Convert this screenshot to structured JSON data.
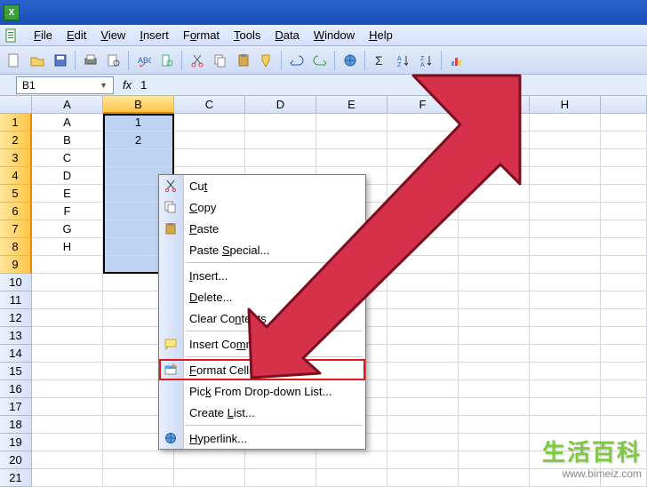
{
  "menubar": {
    "items": [
      {
        "pre": "",
        "ul": "F",
        "post": "ile"
      },
      {
        "pre": "",
        "ul": "E",
        "post": "dit"
      },
      {
        "pre": "",
        "ul": "V",
        "post": "iew"
      },
      {
        "pre": "",
        "ul": "I",
        "post": "nsert"
      },
      {
        "pre": "F",
        "ul": "o",
        "post": "rmat"
      },
      {
        "pre": "",
        "ul": "T",
        "post": "ools"
      },
      {
        "pre": "",
        "ul": "D",
        "post": "ata"
      },
      {
        "pre": "",
        "ul": "W",
        "post": "indow"
      },
      {
        "pre": "",
        "ul": "H",
        "post": "elp"
      }
    ]
  },
  "namebox": {
    "value": "B1"
  },
  "formula": {
    "fx": "fx",
    "value": "1"
  },
  "columns": [
    "A",
    "B",
    "C",
    "D",
    "E",
    "F",
    "G",
    "H"
  ],
  "active_column_index": 1,
  "rows": [
    {
      "n": "1",
      "a": "A",
      "b": "1",
      "active": true
    },
    {
      "n": "2",
      "a": "B",
      "b": "2",
      "active": true
    },
    {
      "n": "3",
      "a": "C",
      "b": "",
      "active": true
    },
    {
      "n": "4",
      "a": "D",
      "b": "",
      "active": true
    },
    {
      "n": "5",
      "a": "E",
      "b": "",
      "active": true
    },
    {
      "n": "6",
      "a": "F",
      "b": "",
      "active": true
    },
    {
      "n": "7",
      "a": "G",
      "b": "",
      "active": true
    },
    {
      "n": "8",
      "a": "H",
      "b": "",
      "active": true
    },
    {
      "n": "9",
      "a": "",
      "b": "",
      "active": true
    },
    {
      "n": "10",
      "a": "",
      "b": "",
      "active": false
    },
    {
      "n": "11",
      "a": "",
      "b": "",
      "active": false
    },
    {
      "n": "12",
      "a": "",
      "b": "",
      "active": false
    },
    {
      "n": "13",
      "a": "",
      "b": "",
      "active": false
    },
    {
      "n": "14",
      "a": "",
      "b": "",
      "active": false
    },
    {
      "n": "15",
      "a": "",
      "b": "",
      "active": false
    },
    {
      "n": "16",
      "a": "",
      "b": "",
      "active": false
    },
    {
      "n": "17",
      "a": "",
      "b": "",
      "active": false
    },
    {
      "n": "18",
      "a": "",
      "b": "",
      "active": false
    },
    {
      "n": "19",
      "a": "",
      "b": "",
      "active": false
    },
    {
      "n": "20",
      "a": "",
      "b": "",
      "active": false
    },
    {
      "n": "21",
      "a": "",
      "b": "",
      "active": false
    }
  ],
  "context_menu": {
    "items": [
      {
        "icon": "cut",
        "pre": "Cu",
        "ul": "t",
        "post": ""
      },
      {
        "icon": "copy",
        "pre": "",
        "ul": "C",
        "post": "opy"
      },
      {
        "icon": "paste",
        "pre": "",
        "ul": "P",
        "post": "aste"
      },
      {
        "icon": "",
        "pre": "Paste ",
        "ul": "S",
        "post": "pecial..."
      },
      {
        "sep": true
      },
      {
        "icon": "",
        "pre": "",
        "ul": "I",
        "post": "nsert..."
      },
      {
        "icon": "",
        "pre": "",
        "ul": "D",
        "post": "elete..."
      },
      {
        "icon": "",
        "pre": "Clear Co",
        "ul": "n",
        "post": "tents"
      },
      {
        "sep": true
      },
      {
        "icon": "comment",
        "pre": "Insert Co",
        "ul": "m",
        "post": "ment"
      },
      {
        "sep": true
      },
      {
        "icon": "format",
        "pre": "",
        "ul": "F",
        "post": "ormat Cells...",
        "highlight": true
      },
      {
        "icon": "",
        "pre": "Pic",
        "ul": "k",
        "post": " From Drop-down List..."
      },
      {
        "icon": "",
        "pre": "Create ",
        "ul": "L",
        "post": "ist..."
      },
      {
        "sep": true
      },
      {
        "icon": "link",
        "pre": "",
        "ul": "H",
        "post": "yperlink..."
      }
    ]
  },
  "watermark": {
    "cn": "生活百科",
    "url": "www.bimeiz.com"
  },
  "colors": {
    "arrow": "#d6314a",
    "arrow_stroke": "#7b0f1f"
  }
}
